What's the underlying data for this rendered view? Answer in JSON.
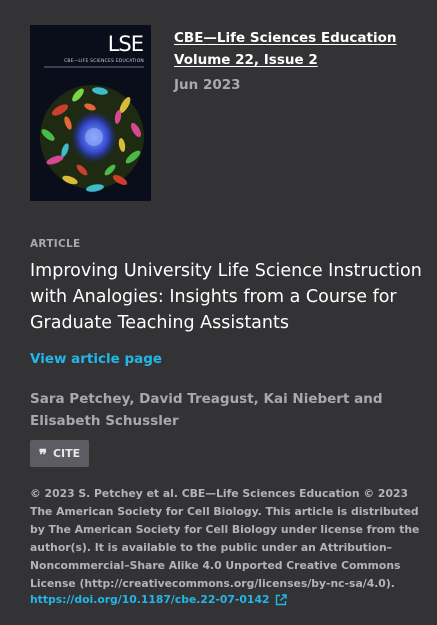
{
  "cover": {
    "journal_abbrev": "LSE",
    "journal_subtitle": "CBE—LIFE SCIENCES EDUCATION"
  },
  "journal": {
    "name": "CBE—Life Sciences Education",
    "volume_issue": "Volume 22, Issue 2",
    "date": "Jun 2023"
  },
  "article": {
    "type": "ARTICLE",
    "title": "Improving University Life Science Instruction with Analogies: Insights from a Course for Graduate Teaching Assistants",
    "view_link": "View article page",
    "authors": "Sara Petchey, David Treagust, Kai Niebert and Elisabeth Schussler"
  },
  "cite": {
    "label": "CITE",
    "icon": "quote-icon"
  },
  "license_text": "© 2023 S. Petchey et al. CBE—Life Sciences Education © 2023 The American Society for Cell Biology. This article is distributed by The American Society for Cell Biology under license from the author(s). It is available to the public under an Attribution–Noncommercial–Share Alike 4.0 Unported Creative Commons License (http://creativecommons.org/licenses/by-nc-sa/4.0).",
  "doi": {
    "link": "https://doi.org/10.1187/cbe.22-07-0142",
    "icon": "external-link-icon"
  },
  "colors": {
    "background": "#333336",
    "accent": "#22b7e8",
    "muted": "#a9a9ad"
  }
}
